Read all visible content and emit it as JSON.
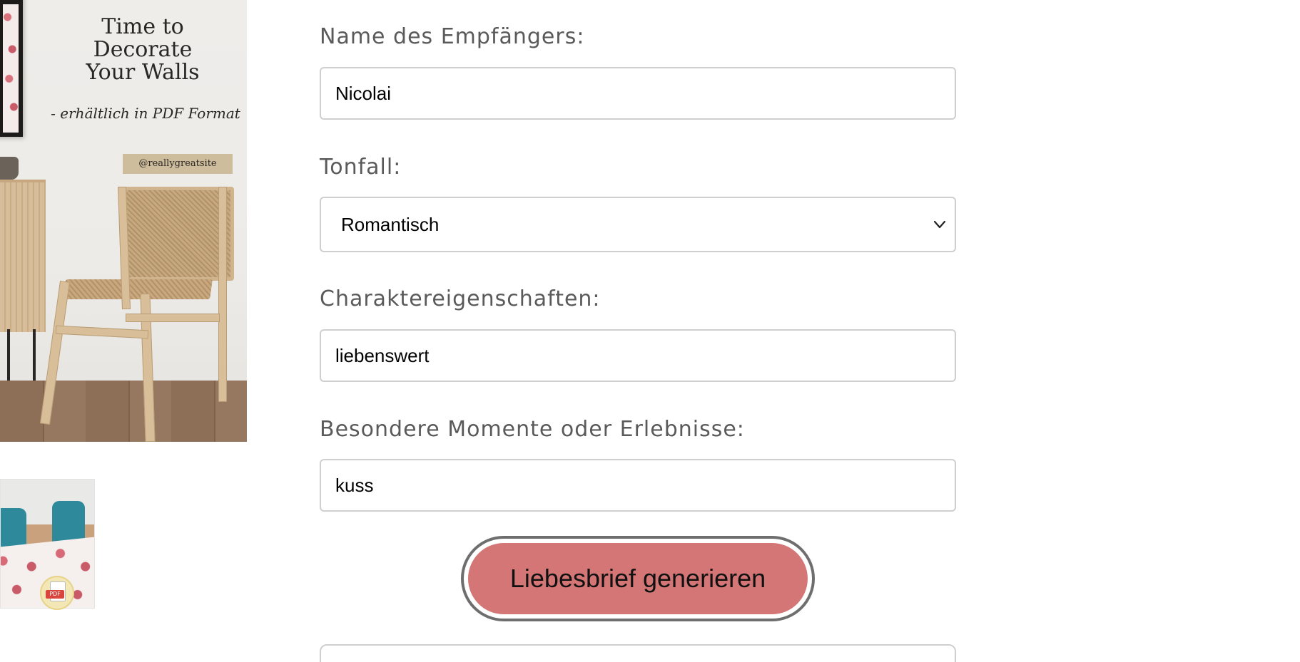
{
  "product": {
    "poster_headline_line1": "Time to Decorate",
    "poster_headline_line2": "Your Walls",
    "poster_subline": "- erhältlich in PDF Format",
    "poster_handle": "@reallygreatsite",
    "thumb_badge": "PDF"
  },
  "form": {
    "recipient": {
      "label": "Name des Empfängers:",
      "value": "Nicolai"
    },
    "tone": {
      "label": "Tonfall:",
      "selected": "Romantisch"
    },
    "traits": {
      "label": "Charaktereigenschaften:",
      "value": "liebenswert"
    },
    "moments": {
      "label": "Besondere Momente oder Erlebnisse:",
      "value": "kuss"
    },
    "generate_label": "Liebesbrief generieren"
  },
  "colors": {
    "button_fill": "#d47675",
    "button_ring": "#6e6e6e",
    "input_border": "#cfcfcf",
    "label_text": "#5a5a5a"
  },
  "icons": {
    "select_arrow": "chevron-down-icon",
    "pdf_badge": "pdf-file-icon"
  }
}
